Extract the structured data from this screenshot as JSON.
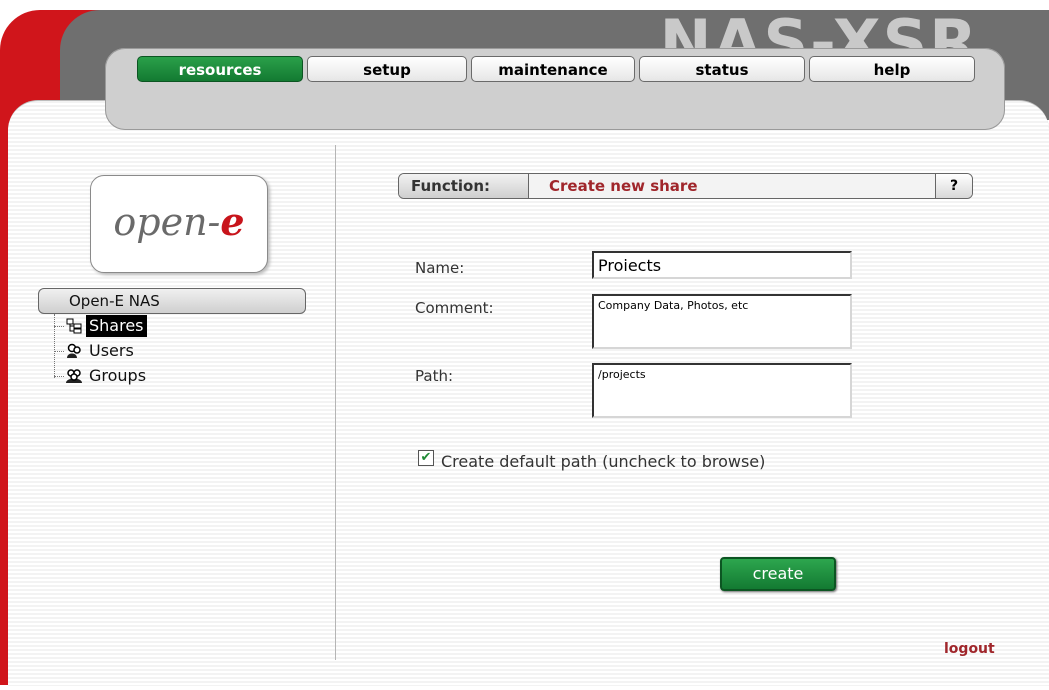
{
  "brand": {
    "title": "NAS-XSR"
  },
  "nav": {
    "tabs": [
      {
        "label": "resources",
        "active": true
      },
      {
        "label": "setup",
        "active": false
      },
      {
        "label": "maintenance",
        "active": false
      },
      {
        "label": "status",
        "active": false
      },
      {
        "label": "help",
        "active": false
      }
    ]
  },
  "logo": {
    "prefix": "open-",
    "suffix": "e"
  },
  "tree": {
    "root": "Open-E NAS",
    "items": [
      {
        "label": "Shares",
        "icon": "shares-icon",
        "selected": true
      },
      {
        "label": "Users",
        "icon": "users-icon",
        "selected": false
      },
      {
        "label": "Groups",
        "icon": "groups-icon",
        "selected": false
      }
    ]
  },
  "function": {
    "label": "Function:",
    "value": "Create new share",
    "help": "?"
  },
  "form": {
    "name_label": "Name:",
    "name_value": "Proiects",
    "comment_label": "Comment:",
    "comment_value": "Company Data, Photos, etc",
    "path_label": "Path:",
    "path_value": "/projects",
    "checkbox_label": "Create default path (uncheck to browse)",
    "checkbox_checked": true,
    "create_label": "create"
  },
  "footer": {
    "logout_label": "logout"
  },
  "colors": {
    "accent_green": "#137a32",
    "brand_red": "#d0151b",
    "function_red": "#a0262b"
  }
}
